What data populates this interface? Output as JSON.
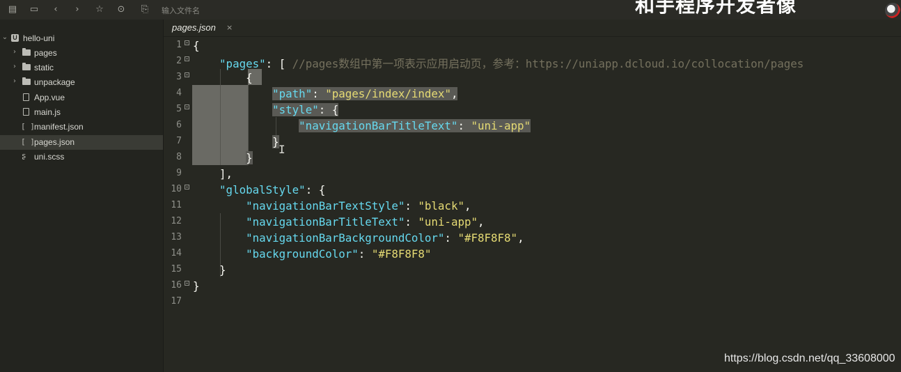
{
  "toolbar": {
    "search_placeholder": "输入文件名",
    "icons": [
      "new-file-icon",
      "save-icon",
      "back-icon",
      "forward-icon",
      "star-icon",
      "run-icon",
      "preview-icon"
    ]
  },
  "overlay": {
    "banner_text": "和手程序开发者像",
    "mark": "、"
  },
  "sidebar": {
    "items": [
      {
        "label": "hello-uni",
        "type": "project",
        "expanded": true
      },
      {
        "label": "pages",
        "type": "folder",
        "collapsed": true
      },
      {
        "label": "static",
        "type": "folder",
        "collapsed": true
      },
      {
        "label": "unpackage",
        "type": "folder",
        "collapsed": true
      },
      {
        "label": "App.vue",
        "type": "file"
      },
      {
        "label": "main.js",
        "type": "file"
      },
      {
        "label": "manifest.json",
        "type": "json"
      },
      {
        "label": "pages.json",
        "type": "json",
        "active": true
      },
      {
        "label": "uni.scss",
        "type": "style"
      }
    ]
  },
  "tab": {
    "label": "pages.json",
    "close": "×"
  },
  "editor": {
    "line_numbers": [
      "1",
      "2",
      "3",
      "4",
      "5",
      "6",
      "7",
      "8",
      "9",
      "10",
      "11",
      "12",
      "13",
      "14",
      "15",
      "16",
      "17"
    ],
    "lines": {
      "l1": "{",
      "l2_key": "\"pages\"",
      "l2_punc": ": [ ",
      "l2_comment": "//pages数组中第一项表示应用启动页，参考：https://uniapp.dcloud.io/collocation/pages",
      "l3": "{",
      "l4_key": "\"path\"",
      "l4_punc": ": ",
      "l4_val": "\"pages/index/index\"",
      "l4_end": ",",
      "l5_key": "\"style\"",
      "l5_punc": ": {",
      "l6_key": "\"navigationBarTitleText\"",
      "l6_punc": ": ",
      "l6_val": "\"uni-app\"",
      "l7": "}",
      "l8": "}",
      "l9": "],",
      "l10_key": "\"globalStyle\"",
      "l10_punc": ": {",
      "l11_key": "\"navigationBarTextStyle\"",
      "l11_punc": ": ",
      "l11_val": "\"black\"",
      "l11_end": ",",
      "l12_key": "\"navigationBarTitleText\"",
      "l12_punc": ": ",
      "l12_val": "\"uni-app\"",
      "l12_end": ",",
      "l13_key": "\"navigationBarBackgroundColor\"",
      "l13_punc": ": ",
      "l13_val": "\"#F8F8F8\"",
      "l13_end": ",",
      "l14_key": "\"backgroundColor\"",
      "l14_punc": ": ",
      "l14_val": "\"#F8F8F8\"",
      "l15": "}",
      "l16": "}",
      "l17": ""
    }
  },
  "watermark": "https://blog.csdn.net/qq_33608000",
  "colors": {
    "background": "#272822",
    "sidebar": "#23241f",
    "key": "#66d9ef",
    "string": "#e6db74",
    "comment": "#75715e"
  }
}
